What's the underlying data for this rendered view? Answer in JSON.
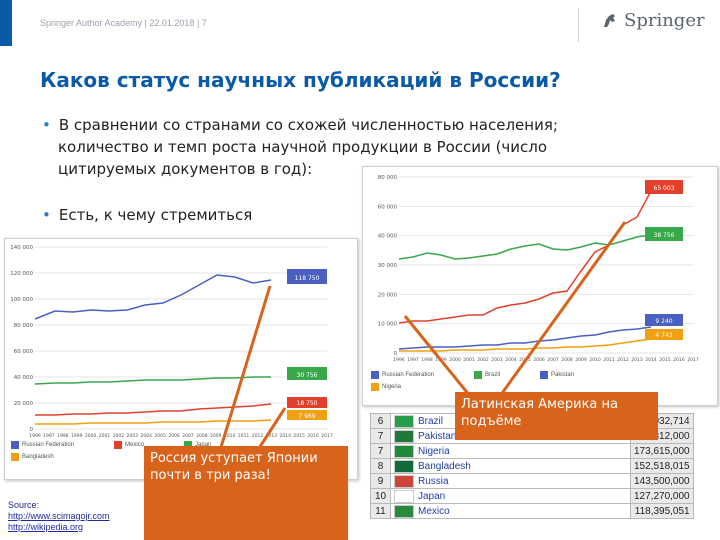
{
  "header": {
    "text": "Springer Author Academy | 22.01.2018 | 7",
    "logo_text": "Springer"
  },
  "title": "Каков статус научных публикаций в России?",
  "bullets": [
    [
      "В сравнении со странами со схожей численностью населения;",
      "количество и темп роста научной продукции в России (число",
      "цитируемых документов в год):"
    ],
    [
      "Есть, к чему стремиться"
    ]
  ],
  "colors": {
    "blue": "#4a5fc1",
    "green": "#38a84a",
    "red": "#e2402c",
    "orange": "#f0a010",
    "accent": "#d8641b",
    "brand": "#0a5aa8"
  },
  "left_chart": {
    "y_ticks": [
      "140 000",
      "120 000",
      "100 000",
      "80 000",
      "60 000",
      "40 000",
      "20 000",
      "0"
    ],
    "x_ticks": [
      "1996",
      "1997",
      "1998",
      "1999",
      "2000",
      "2001",
      "2002",
      "2003",
      "2004",
      "2005",
      "2006",
      "2007",
      "2008",
      "2009",
      "2010",
      "2011",
      "2012",
      "2013",
      "2014",
      "2015",
      "2016",
      "2017"
    ],
    "end_labels": [
      "118 750",
      "30 756",
      "18 750",
      "7 969"
    ],
    "legend": [
      "Russian Federation",
      "Mexico",
      "Japan",
      "Bangladesh"
    ]
  },
  "right_chart": {
    "y_ticks": [
      "80 000",
      "60 000",
      "40 000",
      "30 000",
      "20 000",
      "10 000",
      "0"
    ],
    "x_ticks": [
      "1996",
      "1997",
      "1998",
      "1999",
      "2000",
      "2001",
      "2002",
      "2003",
      "2004",
      "2005",
      "2006",
      "2007",
      "2008",
      "2009",
      "2010",
      "2011",
      "2012",
      "2013",
      "2014",
      "2015",
      "2016",
      "2017"
    ],
    "end_labels": [
      "65 003",
      "38 756",
      "9 240",
      "4 743"
    ],
    "legend": [
      "Russian Federation",
      "Brazil",
      "Pakistan",
      "Nigeria"
    ]
  },
  "source": {
    "label": "Source:",
    "links": [
      "http://www.scimagojr.com",
      "http://wikipedia.org"
    ]
  },
  "callouts": {
    "russia": "Россия уступает Японии почти в три раза!",
    "latam": "Латинская Америка на подъёме"
  },
  "ranking": [
    {
      "rank": "6",
      "country": "Brazil",
      "pop": "201,032,714"
    },
    {
      "rank": "7",
      "country": "Pakistan",
      "pop": "184,312,000"
    },
    {
      "rank": "7",
      "country": "Nigeria",
      "pop": "173,615,000"
    },
    {
      "rank": "8",
      "country": "Bangladesh",
      "pop": "152,518,015"
    },
    {
      "rank": "9",
      "country": "Russia",
      "pop": "143,500,000"
    },
    {
      "rank": "10",
      "country": "Japan",
      "pop": "127,270,000"
    },
    {
      "rank": "11",
      "country": "Mexico",
      "pop": "118,395,051"
    }
  ]
}
